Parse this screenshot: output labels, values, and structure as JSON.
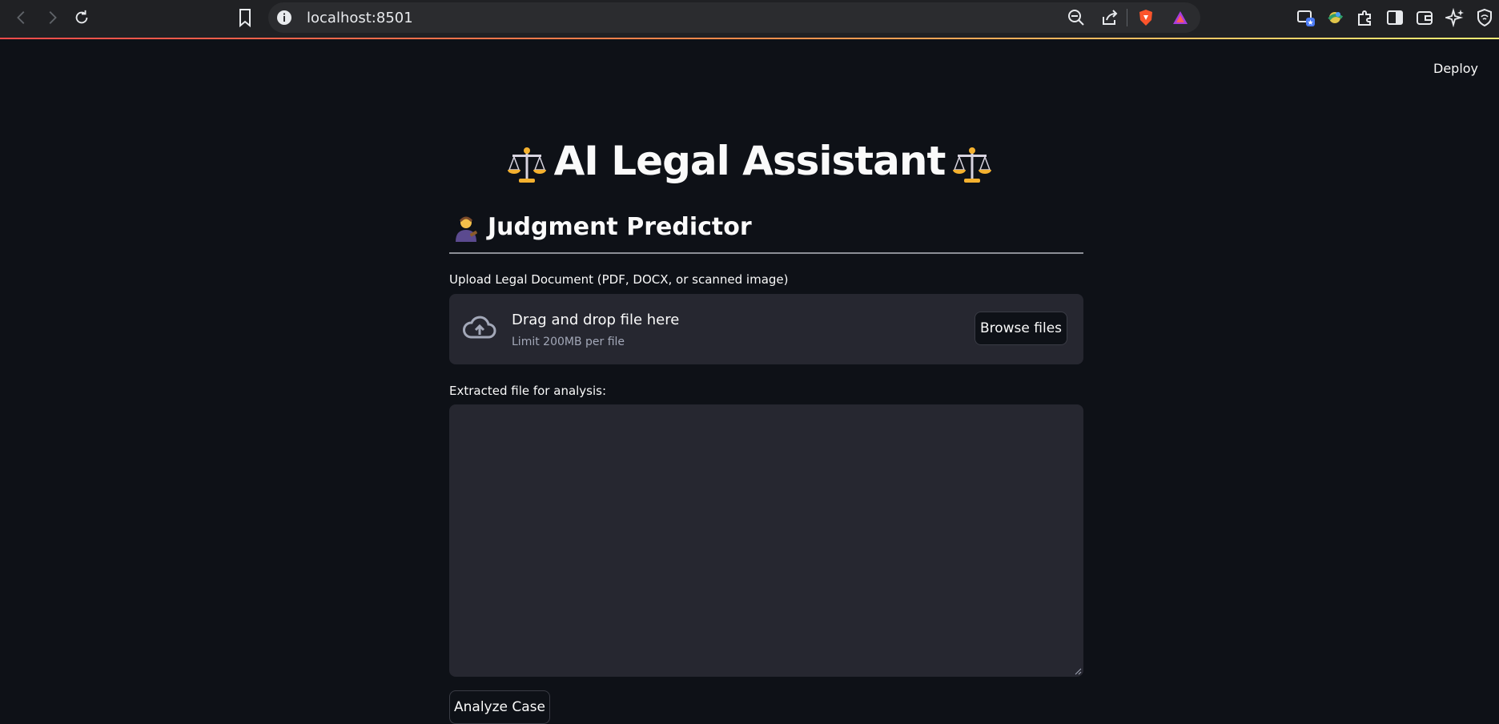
{
  "browser": {
    "url": "localhost:8501"
  },
  "header": {
    "deploy_label": "Deploy"
  },
  "main": {
    "title": "AI Legal Assistant",
    "subheader": "Judgment Predictor",
    "uploader": {
      "label": "Upload Legal Document (PDF, DOCX, or scanned image)",
      "drop_text": "Drag and drop file here",
      "limit_text": "Limit 200MB per file",
      "browse_label": "Browse files"
    },
    "extracted": {
      "label": "Extracted file for analysis:",
      "value": ""
    },
    "analyze_label": "Analyze Case"
  },
  "colors": {
    "background": "#0e1117",
    "panel": "#262730",
    "chrome": "#202124",
    "accent_line": "#ff4b4b"
  },
  "icons": [
    "back-icon",
    "forward-icon",
    "reload-icon",
    "bookmark-icon",
    "info-icon",
    "zoom-icon",
    "share-icon",
    "brave-shield-icon",
    "brave-rewards-icon",
    "picture-in-picture-icon",
    "extension-icon",
    "puzzle-icon",
    "sidebar-icon",
    "wallet-icon",
    "leo-ai-icon",
    "vpn-icon",
    "scales-emoji",
    "judge-emoji",
    "cloud-upload-icon"
  ]
}
